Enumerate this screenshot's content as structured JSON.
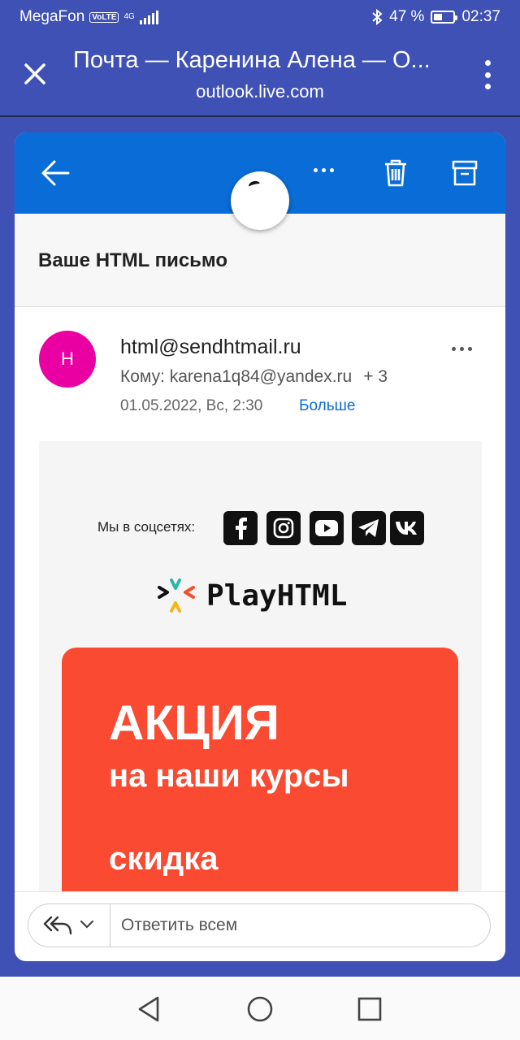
{
  "status_bar": {
    "carrier": "MegaFon",
    "volte": "VoLTE",
    "network": "4G",
    "battery_percent": "47 %",
    "battery_level": 0.47,
    "time": "02:37"
  },
  "browser": {
    "title": "Почта — Каренина Алена — О...",
    "url": "outlook.live.com"
  },
  "mail": {
    "subject": "Ваше HTML письмо",
    "sender_initial": "H",
    "sender": "html@sendhtmail.ru",
    "recipients": "Кому: karena1q84@yandex.ru",
    "extra_recipients": "+ 3",
    "date": "01.05.2022, Вс, 2:30",
    "more_link": "Больше",
    "avatar_color": "#ea00a2",
    "accent": "#0a6cd6"
  },
  "email_content": {
    "social_label": "Мы в соцсетях:",
    "social_icons": [
      "facebook-icon",
      "instagram-icon",
      "youtube-icon",
      "telegram-icon",
      "vk-icon"
    ],
    "logo_text": "PlayHTML",
    "promo": {
      "line1": "АКЦИЯ",
      "line2": "на наши курсы",
      "line3": "скидка",
      "color": "#fa4a32"
    }
  },
  "reply": {
    "placeholder": "Ответить всем"
  }
}
